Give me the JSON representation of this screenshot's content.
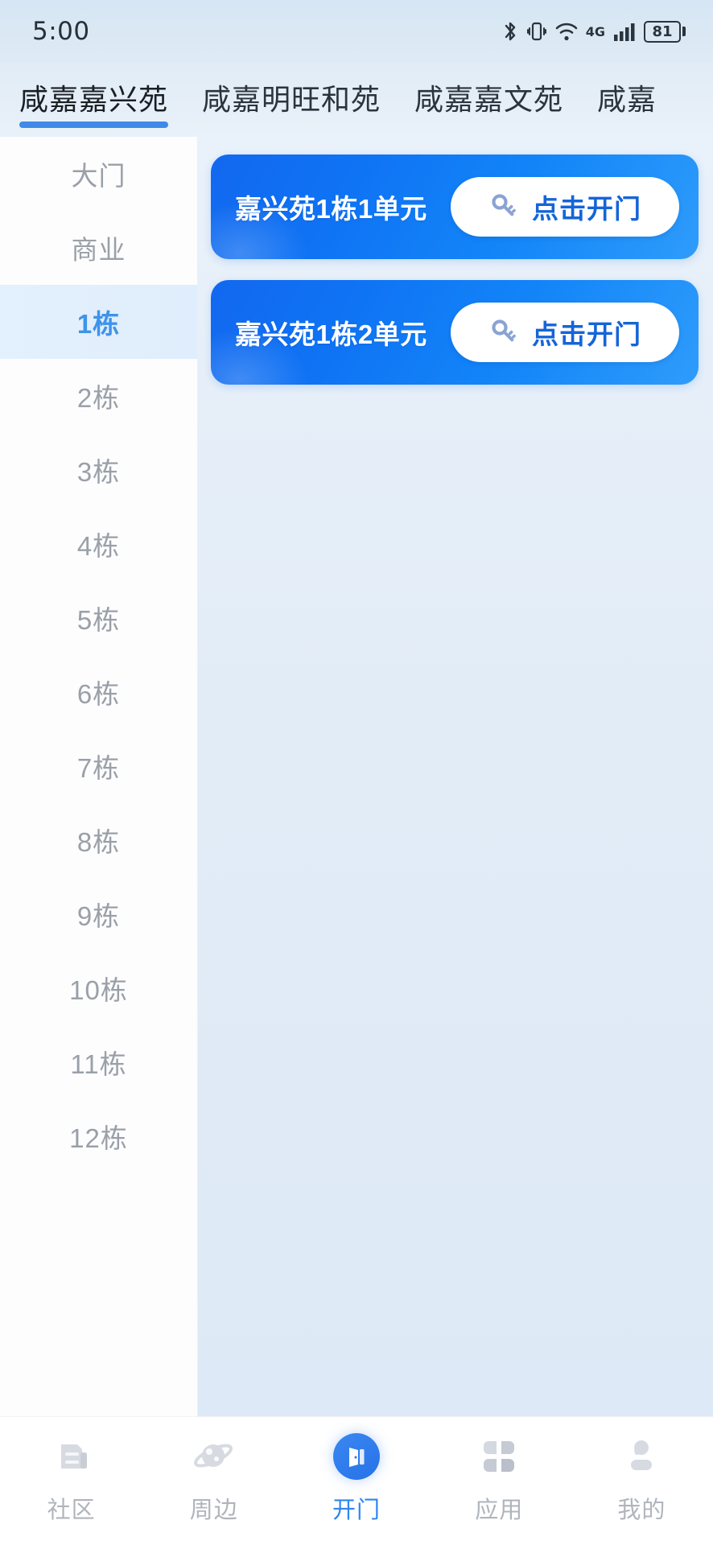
{
  "statusbar": {
    "time": "5:00",
    "battery_percent": "81",
    "network": "4G",
    "icons": [
      "bluetooth-icon",
      "vibrate-icon",
      "wifi-icon",
      "4g-icon",
      "cellular-signal-icon",
      "battery-icon"
    ]
  },
  "tabs": [
    {
      "label": "咸嘉嘉兴苑",
      "active": true
    },
    {
      "label": "咸嘉明旺和苑",
      "active": false
    },
    {
      "label": "咸嘉嘉文苑",
      "active": false
    },
    {
      "label": "咸嘉",
      "active": false
    }
  ],
  "sidebar": {
    "items": [
      {
        "label": "大门",
        "active": false
      },
      {
        "label": "商业",
        "active": false
      },
      {
        "label": "1栋",
        "active": true
      },
      {
        "label": "2栋",
        "active": false
      },
      {
        "label": "3栋",
        "active": false
      },
      {
        "label": "4栋",
        "active": false
      },
      {
        "label": "5栋",
        "active": false
      },
      {
        "label": "6栋",
        "active": false
      },
      {
        "label": "7栋",
        "active": false
      },
      {
        "label": "8栋",
        "active": false
      },
      {
        "label": "9栋",
        "active": false
      },
      {
        "label": "10栋",
        "active": false
      },
      {
        "label": "11栋",
        "active": false
      },
      {
        "label": "12栋",
        "active": false
      }
    ]
  },
  "main": {
    "doors": [
      {
        "name": "嘉兴苑1栋1单元",
        "button_label": "点击开门"
      },
      {
        "name": "嘉兴苑1栋2单元",
        "button_label": "点击开门"
      }
    ]
  },
  "bottomnav": {
    "items": [
      {
        "label": "社区",
        "icon": "community-icon",
        "active": false
      },
      {
        "label": "周边",
        "icon": "nearby-planet-icon",
        "active": false
      },
      {
        "label": "开门",
        "icon": "door-open-icon",
        "active": true
      },
      {
        "label": "应用",
        "icon": "apps-grid-icon",
        "active": false
      },
      {
        "label": "我的",
        "icon": "profile-person-icon",
        "active": false
      }
    ]
  },
  "colors": {
    "accent": "#2f86ef",
    "card_gradient_start": "#1268ef",
    "card_gradient_end": "#2e9cfb",
    "button_text": "#1565d8",
    "inactive_text": "#9aa0a8"
  }
}
